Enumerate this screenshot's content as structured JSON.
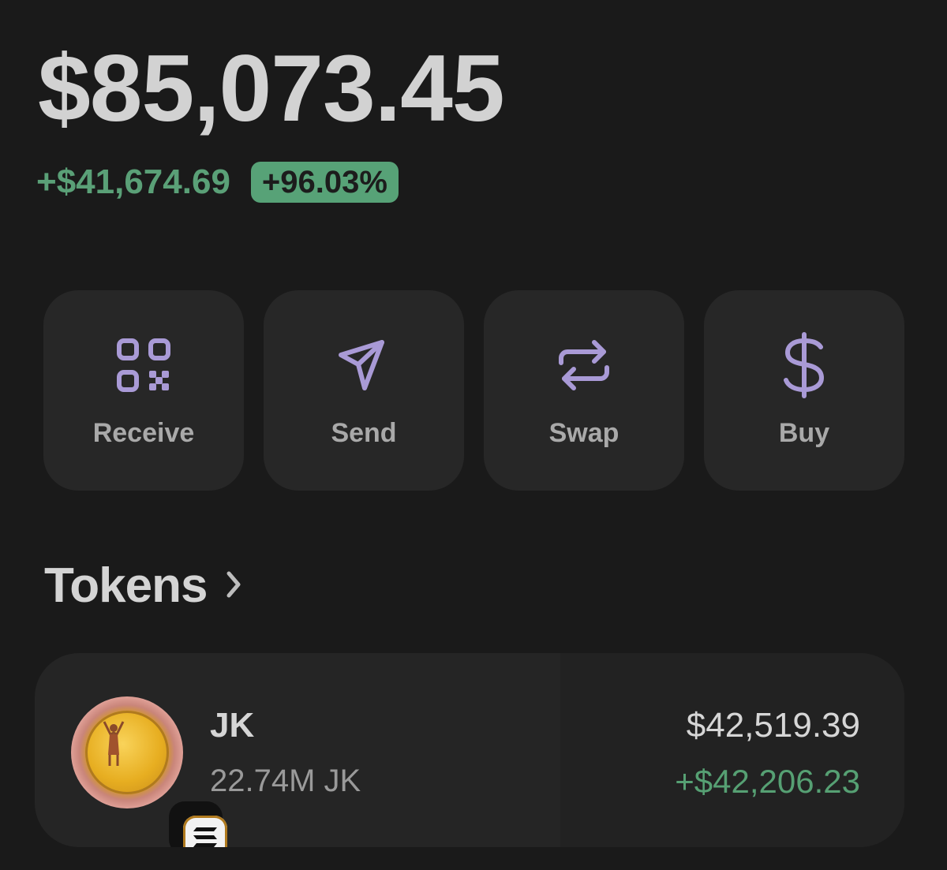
{
  "portfolio": {
    "balance": "$85,073.45",
    "change_amount": "+$41,674.69",
    "change_percent": "+96.03%",
    "positive_color": "#57a277"
  },
  "actions": [
    {
      "label": "Receive",
      "icon": "qr-code-icon"
    },
    {
      "label": "Send",
      "icon": "send-arrow-icon"
    },
    {
      "label": "Swap",
      "icon": "swap-arrows-icon"
    },
    {
      "label": "Buy",
      "icon": "dollar-icon"
    }
  ],
  "accent_color": "#a99ad6",
  "tokens": {
    "title": "Tokens",
    "items": [
      {
        "name": "JK",
        "quantity": "22.74M JK",
        "value": "$42,519.39",
        "change": "+$42,206.23",
        "chain_icon": "solana-icon"
      }
    ]
  }
}
